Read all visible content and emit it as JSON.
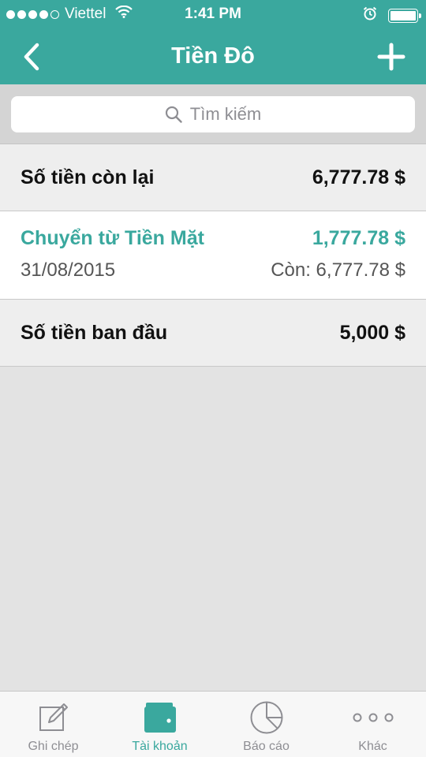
{
  "status_bar": {
    "carrier": "Viettel",
    "time": "1:41 PM"
  },
  "nav": {
    "title": "Tiền Đô",
    "back_icon": "chevron-left-icon",
    "add_icon": "plus-icon"
  },
  "search": {
    "placeholder": "Tìm kiếm",
    "icon": "search-icon"
  },
  "remaining": {
    "label": "Số tiền còn lại",
    "value": "6,777.78 $"
  },
  "transaction": {
    "title": "Chuyển từ Tiền Mặt",
    "amount": "1,777.78 $",
    "date": "31/08/2015",
    "balance": "Còn: 6,777.78 $"
  },
  "initial": {
    "label": "Số tiền ban đầu",
    "value": "5,000 $"
  },
  "tabs": [
    {
      "label": "Ghi chép",
      "icon": "note-edit-icon",
      "active": false
    },
    {
      "label": "Tài khoản",
      "icon": "wallet-icon",
      "active": true
    },
    {
      "label": "Báo cáo",
      "icon": "pie-chart-icon",
      "active": false
    },
    {
      "label": "Khác",
      "icon": "more-dots-icon",
      "active": false
    }
  ],
  "colors": {
    "accent": "#3aa89e",
    "background": "#e3e3e3",
    "inactive_tab": "#8e8e93"
  }
}
